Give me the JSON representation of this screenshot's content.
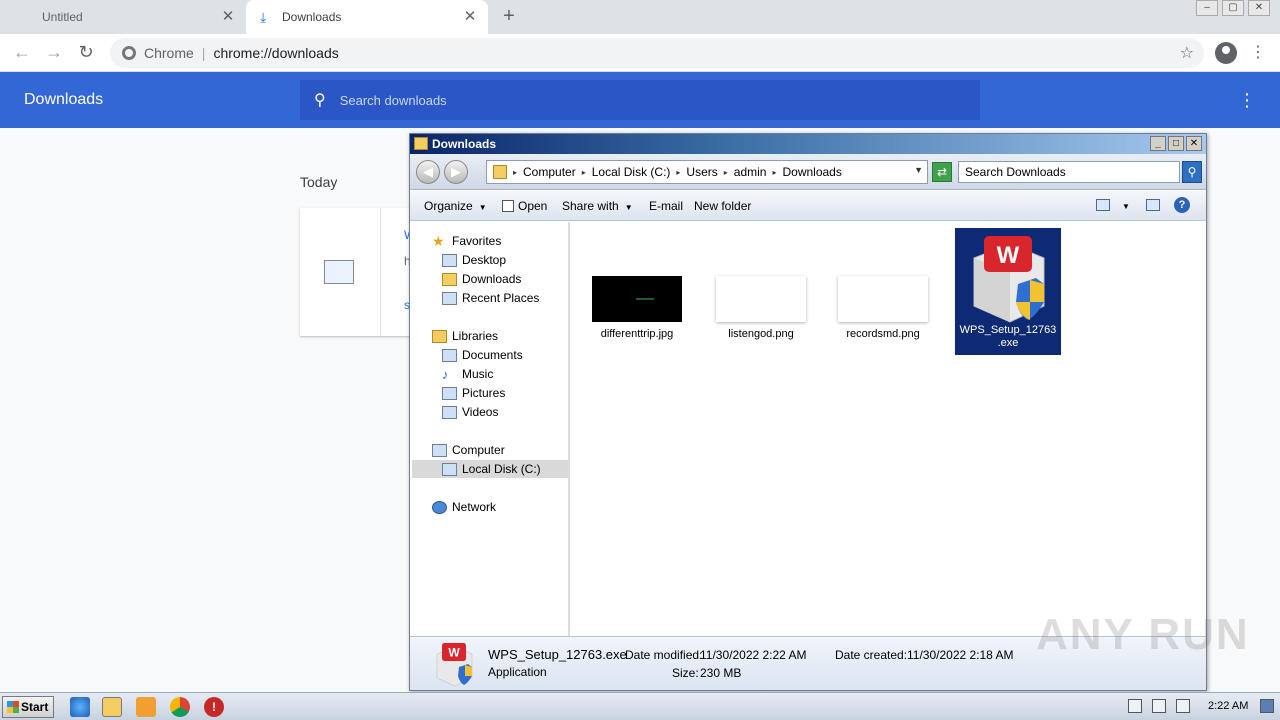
{
  "chrome": {
    "tabs": [
      {
        "label": "Untitled",
        "active": false
      },
      {
        "label": "Downloads",
        "active": true
      }
    ],
    "omnibox": {
      "site": "Chrome",
      "url": "chrome://downloads"
    },
    "page": {
      "title": "Downloads",
      "search_placeholder": "Search downloads",
      "section": "Today",
      "card_letters": [
        "W",
        "h",
        "s"
      ]
    }
  },
  "explorer": {
    "title": "Downloads",
    "breadcrumb": [
      "Computer",
      "Local Disk (C:)",
      "Users",
      "admin",
      "Downloads"
    ],
    "search_placeholder": "Search Downloads",
    "commands": {
      "organize": "Organize",
      "open": "Open",
      "share": "Share with",
      "email": "E-mail",
      "new_folder": "New folder"
    },
    "nav": {
      "favorites": "Favorites",
      "fav_items": [
        "Desktop",
        "Downloads",
        "Recent Places"
      ],
      "libraries": "Libraries",
      "lib_items": [
        "Documents",
        "Music",
        "Pictures",
        "Videos"
      ],
      "computer": "Computer",
      "computer_items": [
        "Local Disk (C:)"
      ],
      "network": "Network"
    },
    "files": [
      {
        "name": "differenttrip.jpg"
      },
      {
        "name": "listengod.png"
      },
      {
        "name": "recordsmd.png"
      },
      {
        "name_line1": "WPS_Setup_12763",
        "name_line2": ".exe"
      }
    ],
    "details": {
      "name": "WPS_Setup_12763.exe",
      "type": "Application",
      "modified_label": "Date modified:",
      "modified": "11/30/2022 2:22 AM",
      "created_label": "Date created:",
      "created": "11/30/2022 2:18 AM",
      "size_label": "Size:",
      "size": "230 MB"
    }
  },
  "taskbar": {
    "start": "Start",
    "clock": "2:22 AM"
  },
  "watermark": "ANY RUN",
  "colors": {
    "chrome_header": "#3367d6",
    "selection": "#0e2a74"
  }
}
